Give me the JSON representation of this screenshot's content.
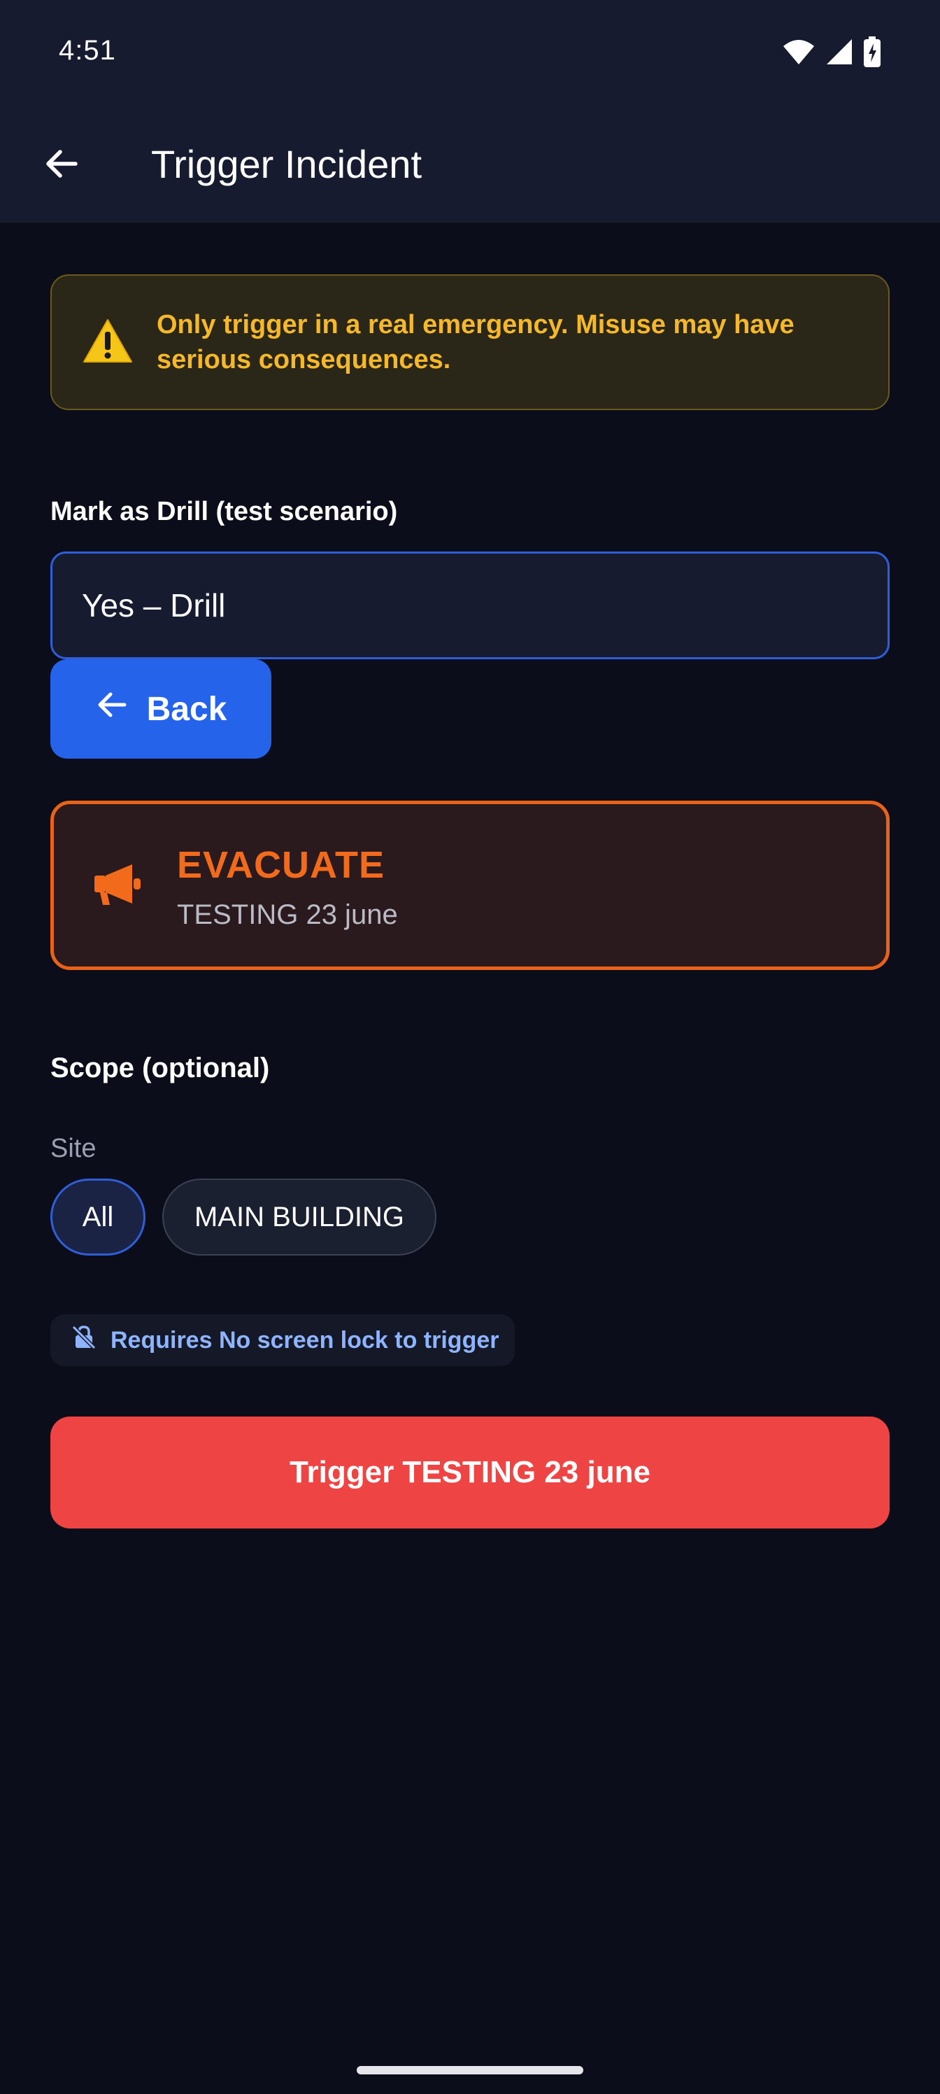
{
  "status_bar": {
    "time": "4:51",
    "icons": [
      "wifi-icon",
      "signal-icon",
      "battery-charging-icon"
    ]
  },
  "app_bar": {
    "back_icon": "arrow-left-icon",
    "title": "Trigger Incident"
  },
  "warning": {
    "icon": "warning-icon",
    "text": "Only trigger in a real emergency. Misuse may have serious consequences."
  },
  "drill": {
    "label": "Mark as Drill (test scenario)",
    "selected_value": "Yes – Drill"
  },
  "back_button": {
    "icon": "arrow-left-icon",
    "label": "Back"
  },
  "incident_card": {
    "icon": "megaphone-icon",
    "title": "EVACUATE",
    "subtitle": "TESTING 23 june"
  },
  "scope": {
    "title": "Scope (optional)",
    "site_label": "Site",
    "chips": [
      {
        "label": "All",
        "selected": true
      },
      {
        "label": "MAIN BUILDING",
        "selected": false
      }
    ]
  },
  "requirement": {
    "icon": "lock-off-icon",
    "text": "Requires No screen lock to trigger"
  },
  "trigger_button": {
    "label": "Trigger TESTING 23 june"
  },
  "colors": {
    "background": "#0b0e1a",
    "app_bar": "#161b2f",
    "warning_text": "#f5b82a",
    "accent_blue": "#2563eb",
    "evacuate_orange": "#f26a1b",
    "trigger_red": "#ef4444"
  }
}
